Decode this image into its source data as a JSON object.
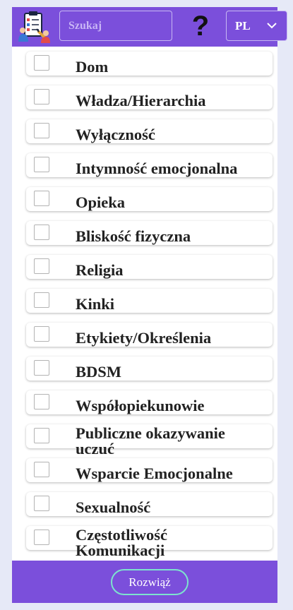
{
  "header": {
    "logo_icon": "checklist-clipboard-icon",
    "search_placeholder": "Szukaj",
    "help_label": "?",
    "language": {
      "value": "PL"
    }
  },
  "items": [
    {
      "label": "Dom"
    },
    {
      "label": "Władza/Hierarchia"
    },
    {
      "label": "Wyłączność"
    },
    {
      "label": "Intymność emocjonalna"
    },
    {
      "label": "Opieka"
    },
    {
      "label": "Bliskość fizyczna"
    },
    {
      "label": "Religia"
    },
    {
      "label": "Kinki"
    },
    {
      "label": "Etykiety/Określenia"
    },
    {
      "label": "BDSM"
    },
    {
      "label": "Współopiekunowie"
    },
    {
      "label": "Publiczne okazywanie uczuć",
      "lines": [
        "Publiczne okazywanie",
        "uczuć"
      ]
    },
    {
      "label": "Wsparcie Emocjonalne"
    },
    {
      "label": "Sexualność"
    },
    {
      "label": "Częstotliwość Komunikacji",
      "lines": [
        "Częstotliwość",
        "Komunikacji"
      ]
    }
  ],
  "footer": {
    "solve_label": "Rozwiąż"
  },
  "colors": {
    "accent": "#7b4fdb",
    "button_border": "#7de3ce",
    "background": "#e6e9f7"
  }
}
